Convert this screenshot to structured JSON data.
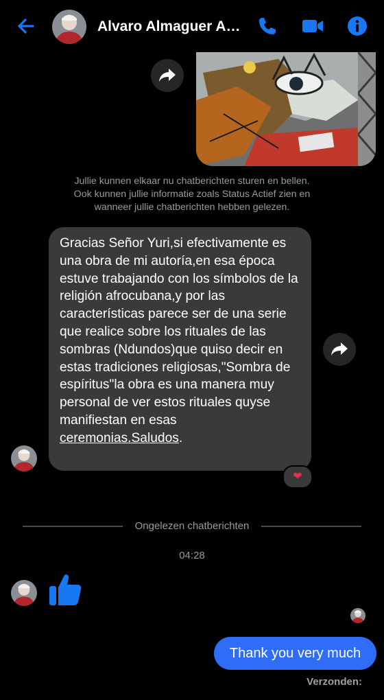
{
  "header": {
    "contact_name": "Alvaro Almaguer Al...",
    "back_icon": "arrow-left-icon",
    "call_icon": "phone-icon",
    "video_icon": "video-camera-icon",
    "info_icon": "info-icon",
    "accent_color": "#1877f2"
  },
  "messages": {
    "notice_line1": "Jullie kunnen elkaar nu chatberichten sturen en bellen.",
    "notice_line2": "Ook kunnen jullie informatie zoals Status Actief zien en",
    "notice_line3": "wanneer jullie chatberichten hebben gelezen.",
    "incoming_text": "Gracias Señor Yuri,si efectivamente es una obra de mi autoría,en esa época estuve trabajando con los símbolos de la religión afrocubana,y por las características parece ser de una serie que realice sobre los rituales de las sombras (Ndundos)que quiso decir en estas tradiciones religiosas,\"Sombra de espíritus\"la obra es una manera muy personal de ver estos rituales quyse manifiestan en esas ",
    "incoming_link": "ceremonias.Saludos",
    "incoming_end": ".",
    "reaction": "❤",
    "unread_divider": "Ongelezen chatberichten",
    "timestamp": "04:28",
    "thumbs_up_icon": "thumbs-up-icon",
    "outgoing_text": "Thank you very much",
    "outgoing_color": "#2f6df6",
    "status": "Verzonden:"
  }
}
